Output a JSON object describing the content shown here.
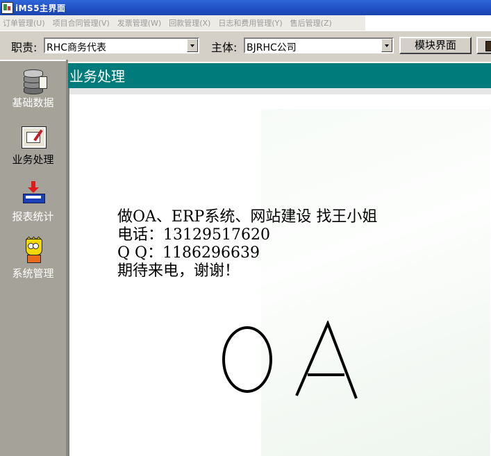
{
  "window": {
    "title": "iMS5主界面"
  },
  "menu": [
    "订单管理(U)",
    "项目合同管理(V)",
    "发票管理(W)",
    "回款管理(X)",
    "日志和费用管理(Y)",
    "售后管理(Z)"
  ],
  "toolbar": {
    "role_label": "职责:",
    "role_value": "RHC商务代表",
    "entity_label": "主体:",
    "entity_value": "BJRHC公司",
    "module_button": "模块界面"
  },
  "sidebar": [
    {
      "label": "基础数据",
      "icon": "database-icon"
    },
    {
      "label": "业务处理",
      "icon": "business-doc-icon",
      "selected": true
    },
    {
      "label": "报表统计",
      "icon": "report-download-icon"
    },
    {
      "label": "系统管理",
      "icon": "system-admin-icon"
    }
  ],
  "section": {
    "title": "业务处理"
  },
  "promo": {
    "line1": "做OA、ERP系统、网站建设 找王小姐",
    "line2": "电话：13129517620",
    "line3": "Q  Q：1186296639",
    "line4": "期待来电，谢谢！"
  },
  "logo_text": "OA",
  "colors": {
    "titlebar": "#1f4fc2",
    "section_header": "#007b7b",
    "sidebar": "#a5a399"
  }
}
